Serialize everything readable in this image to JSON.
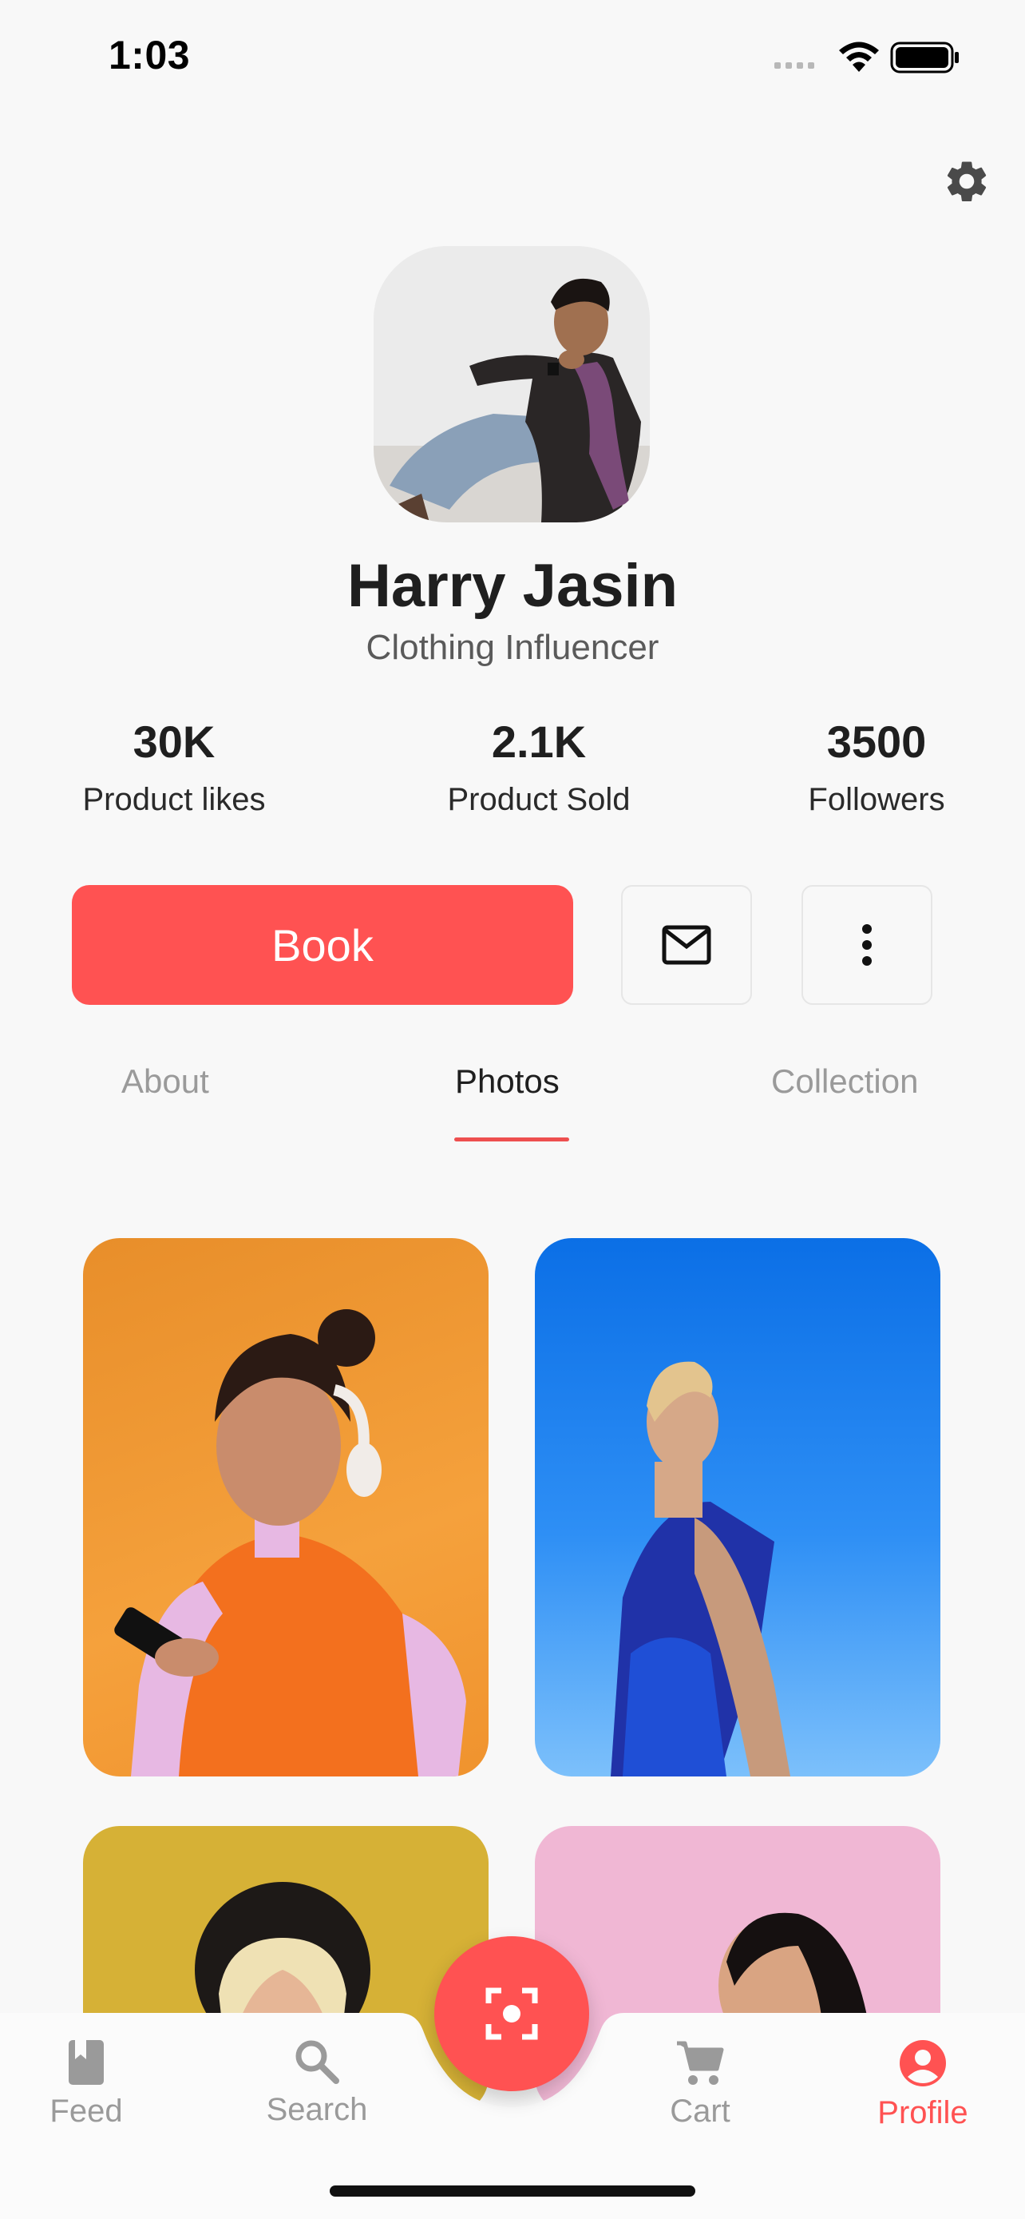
{
  "status_bar": {
    "time": "1:03"
  },
  "profile": {
    "name": "Harry Jasin",
    "role": "Clothing Influencer"
  },
  "stats": [
    {
      "value": "30K",
      "label": "Product likes"
    },
    {
      "value": "2.1K",
      "label": "Product Sold"
    },
    {
      "value": "3500",
      "label": "Followers"
    }
  ],
  "actions": {
    "book_label": "Book",
    "mail_icon": "mail-icon",
    "more_icon": "more-vertical-icon"
  },
  "tabs": [
    {
      "label": "About",
      "active": false
    },
    {
      "label": "Photos",
      "active": true
    },
    {
      "label": "Collection",
      "active": false
    }
  ],
  "bottom_nav": [
    {
      "label": "Feed",
      "icon": "book-icon",
      "active": false
    },
    {
      "label": "Search",
      "icon": "search-icon",
      "active": false
    },
    {
      "label": "Cart",
      "icon": "cart-icon",
      "active": false
    },
    {
      "label": "Profile",
      "icon": "account-circle-icon",
      "active": true
    }
  ],
  "colors": {
    "accent": "#ff5252",
    "background": "#f8f8f8",
    "inactive": "#9a9a9a"
  }
}
